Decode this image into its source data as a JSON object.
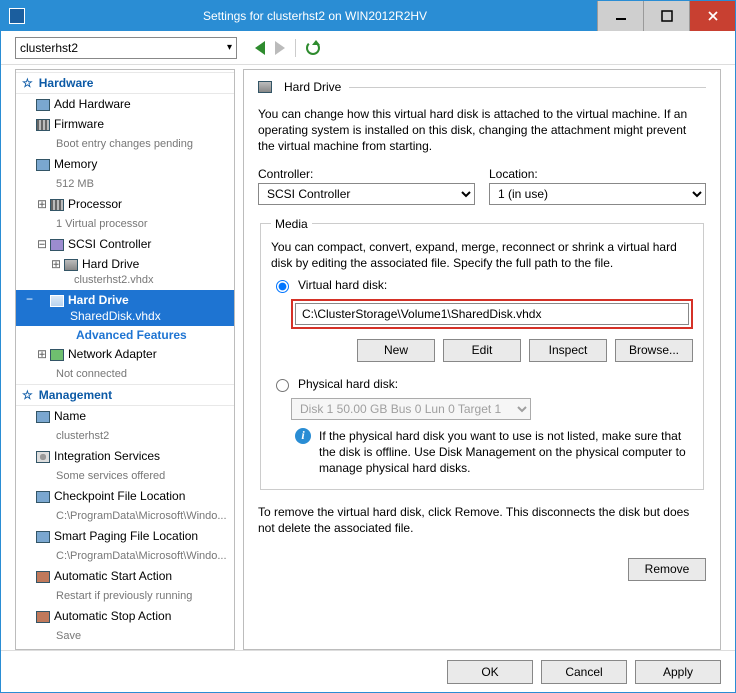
{
  "window": {
    "title": "Settings for clusterhst2 on WIN2012R2HV"
  },
  "toolbar": {
    "vm_select_value": "clusterhst2"
  },
  "sidebar": {
    "hardware_label": "Hardware",
    "management_label": "Management",
    "add_hardware": "Add Hardware",
    "firmware": "Firmware",
    "firmware_sub": "Boot entry changes pending",
    "memory": "Memory",
    "memory_sub": "512 MB",
    "processor": "Processor",
    "processor_sub": "1 Virtual processor",
    "scsi": "SCSI Controller",
    "hd1": "Hard Drive",
    "hd1_sub": "clusterhst2.vhdx",
    "hd2": "Hard Drive",
    "hd2_sub": "SharedDisk.vhdx",
    "adv": "Advanced Features",
    "net": "Network Adapter",
    "net_sub": "Not connected",
    "name": "Name",
    "name_sub": "clusterhst2",
    "integ": "Integration Services",
    "integ_sub": "Some services offered",
    "checkpoint": "Checkpoint File Location",
    "checkpoint_sub": "C:\\ProgramData\\Microsoft\\Windo...",
    "smart": "Smart Paging File Location",
    "smart_sub": "C:\\ProgramData\\Microsoft\\Windo...",
    "autostart": "Automatic Start Action",
    "autostart_sub": "Restart if previously running",
    "autostop": "Automatic Stop Action",
    "autostop_sub": "Save"
  },
  "panel": {
    "title": "Hard Drive",
    "desc": "You can change how this virtual hard disk is attached to the virtual machine. If an operating system is installed on this disk, changing the attachment might prevent the virtual machine from starting.",
    "controller_label": "Controller:",
    "controller_value": "SCSI Controller",
    "location_label": "Location:",
    "location_value": "1 (in use)",
    "media_legend": "Media",
    "media_desc": "You can compact, convert, expand, merge, reconnect or shrink a virtual hard disk by editing the associated file. Specify the full path to the file.",
    "radio_vhd": "Virtual hard disk:",
    "vhd_path": "C:\\ClusterStorage\\Volume1\\SharedDisk.vhdx",
    "btn_new": "New",
    "btn_edit": "Edit",
    "btn_inspect": "Inspect",
    "btn_browse": "Browse...",
    "radio_phys": "Physical hard disk:",
    "phys_value": "Disk 1 50.00 GB Bus 0 Lun 0 Target 1",
    "phys_info": "If the physical hard disk you want to use is not listed, make sure that the disk is offline. Use Disk Management on the physical computer to manage physical hard disks.",
    "remove_desc": "To remove the virtual hard disk, click Remove. This disconnects the disk but does not delete the associated file.",
    "btn_remove": "Remove"
  },
  "footer": {
    "ok": "OK",
    "cancel": "Cancel",
    "apply": "Apply"
  }
}
